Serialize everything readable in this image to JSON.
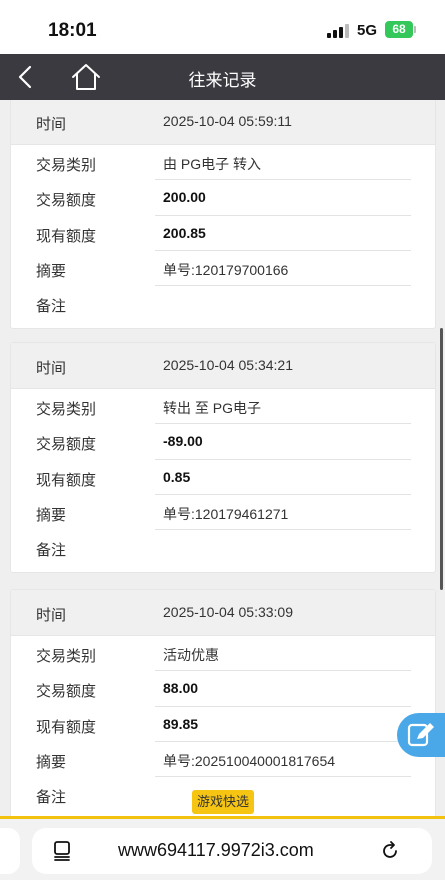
{
  "status": {
    "time": "18:01",
    "network": "5G",
    "battery": "68"
  },
  "nav": {
    "title": "往来记录"
  },
  "labels": {
    "time": "时间",
    "type": "交易类别",
    "amount": "交易额度",
    "balance": "现有额度",
    "summary": "摘要",
    "note": "备注"
  },
  "records": [
    {
      "time": "2025-10-04 05:59:11",
      "type": "由 PG电子 转入",
      "amount": "200.00",
      "balance": "200.85",
      "summary": "单号:120179700166",
      "note": ""
    },
    {
      "time": "2025-10-04 05:34:21",
      "type": "转出 至 PG电子",
      "amount": "-89.00",
      "balance": "0.85",
      "summary": "单号:120179461271",
      "note": ""
    },
    {
      "time": "2025-10-04 05:33:09",
      "type": "活动优惠",
      "amount": "88.00",
      "balance": "89.85",
      "summary": "单号:202510040001817654",
      "note": ""
    }
  ],
  "floating": {
    "game_quick": "游戏快选"
  },
  "browser": {
    "url": "www694117.9972i3.com"
  },
  "icons": {
    "back": "chevron-left-icon",
    "home": "home-icon",
    "edit": "edit-icon",
    "tabs": "tabs-icon",
    "reload": "reload-icon"
  },
  "colors": {
    "nav_bg": "#3a3a40",
    "battery": "#34c759",
    "fab": "#4aa8e8",
    "badge": "#f6c513"
  }
}
